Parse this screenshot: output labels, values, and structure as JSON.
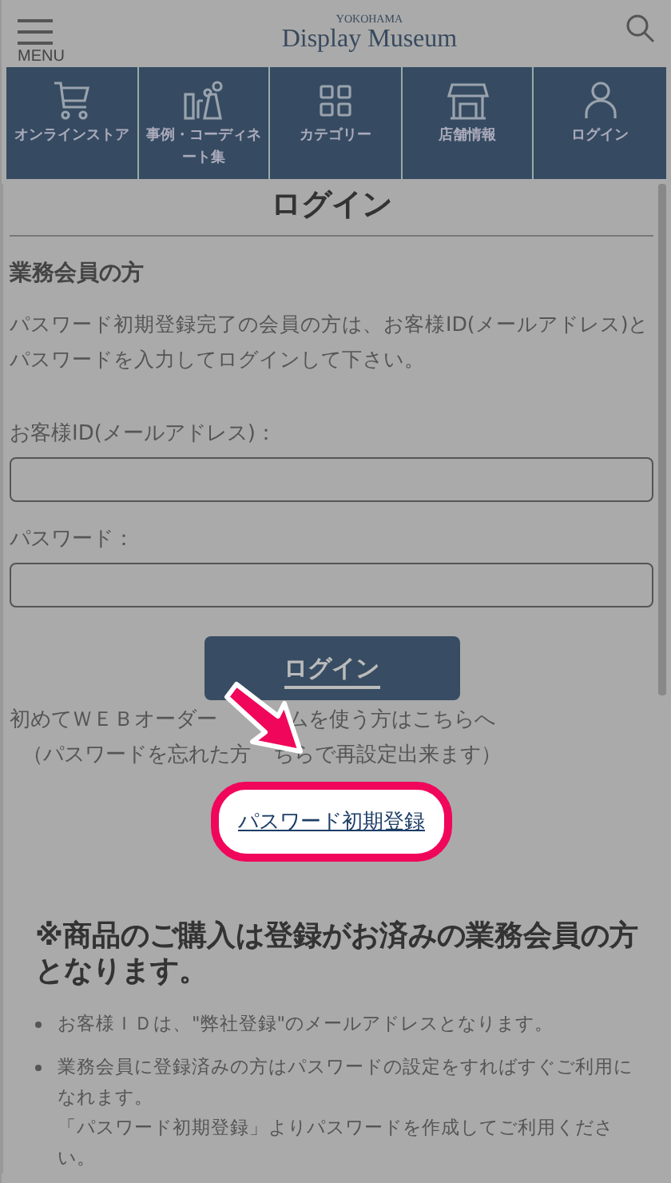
{
  "header": {
    "menu_label": "MENU",
    "logo_small": "YOKOHAMA",
    "logo_main": "Display Museum"
  },
  "nav": [
    {
      "kind": "cart",
      "label": "オンラインストア"
    },
    {
      "kind": "items",
      "label": "事例・コーディネート集"
    },
    {
      "kind": "grid",
      "label": "カテゴリー"
    },
    {
      "kind": "store",
      "label": "店舗情報"
    },
    {
      "kind": "person",
      "label": "ログイン"
    }
  ],
  "title": "ログイン",
  "section_heading": "業務会員の方",
  "intro": "パスワード初期登録完了の会員の方は、お客様ID(メールアドレス)とパスワードを入力してログインして下さい。",
  "fields": [
    {
      "label": "お客様ID(メールアドレス)："
    },
    {
      "label": "パスワード："
    }
  ],
  "login_button": "ログイン",
  "first_time_parts": [
    "初めてＷＥＢオーダー",
    "ムを使う方はこちらへ"
  ],
  "forgot_parts": [
    "（パスワードを忘れた方",
    "ちらで再設定出来ます）"
  ],
  "register_link": "パスワード初期登録",
  "notice_heading": "※商品のご購入は登録がお済みの業務会員の方となります。",
  "notes": [
    {
      "lines": [
        "お客様ＩＤは、\"弊社登録\"のメールアドレスとなります。"
      ]
    },
    {
      "lines": [
        "業務会員に登録済みの方はパスワードの設定をすればすぐご利用になれます。",
        "「パスワード初期登録」よりパスワードを作成してご利用ください。"
      ]
    }
  ]
}
